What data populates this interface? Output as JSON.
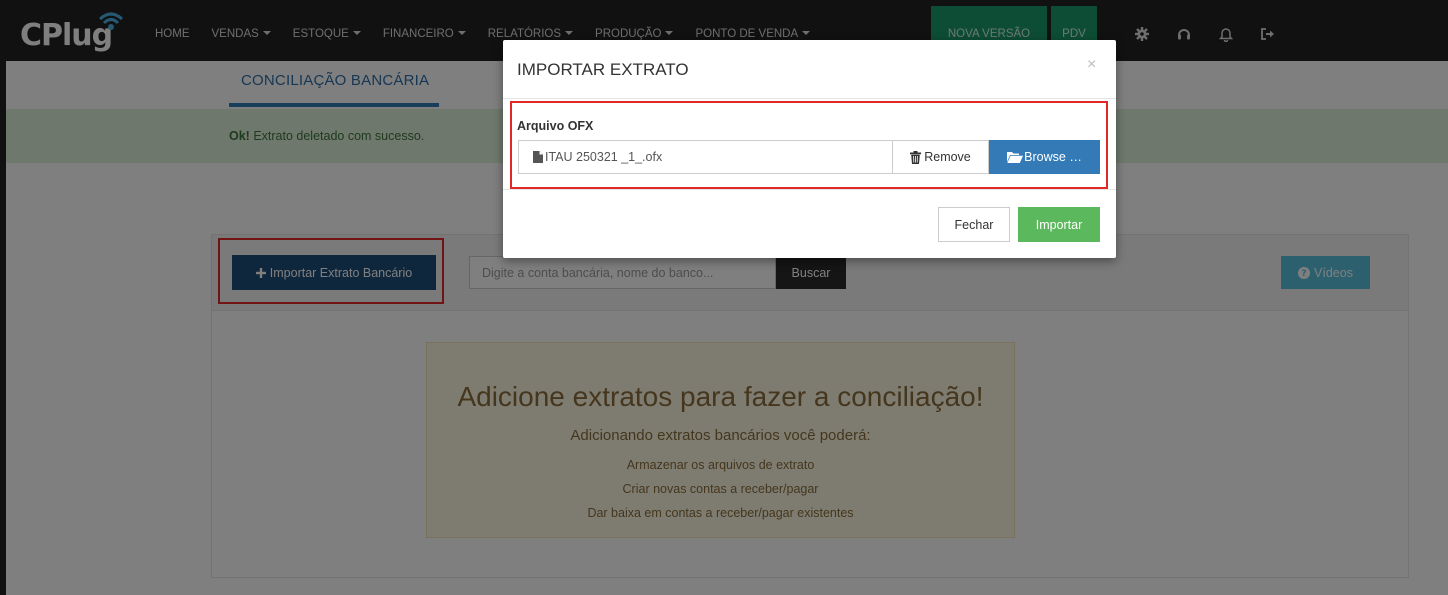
{
  "navbar": {
    "logo_text": "CPlug",
    "items": [
      {
        "label": "HOME",
        "dropdown": false
      },
      {
        "label": "VENDAS",
        "dropdown": true
      },
      {
        "label": "ESTOQUE",
        "dropdown": true
      },
      {
        "label": "FINANCEIRO",
        "dropdown": true
      },
      {
        "label": "RELATÓRIOS",
        "dropdown": true
      },
      {
        "label": "PRODUÇÃO",
        "dropdown": true
      },
      {
        "label": "PONTO DE VENDA",
        "dropdown": true
      }
    ],
    "nova_versao": "NOVA VERSÃO",
    "pdv": "PDV",
    "icons": [
      "gear-icon",
      "headset-icon",
      "bell-icon",
      "logout-icon"
    ]
  },
  "page": {
    "tab_label": "CONCILIAÇÃO BANCÁRIA",
    "alert_strong": "Ok!",
    "alert_text": " Extrato deletado com sucesso.",
    "import_button": "Importar Extrato Bancário",
    "search_placeholder": "Digite a conta bancária, nome do banco...",
    "search_button": "Buscar",
    "videos_button": "Vídeos",
    "empty_title": "Adicione extratos para fazer a conciliação!",
    "empty_subtitle": "Adicionando extratos bancários você poderá:",
    "empty_items": [
      "Armazenar os arquivos de extrato",
      "Criar novas contas a receber/pagar",
      "Dar baixa em contas a receber/pagar existentes"
    ]
  },
  "modal": {
    "title": "IMPORTAR EXTRATO",
    "close": "×",
    "field_label": "Arquivo OFX",
    "file_name": "ITAU 250321 _1_.ofx",
    "remove_button": "Remove",
    "browse_button": "Browse …",
    "fechar_button": "Fechar",
    "importar_button": "Importar"
  },
  "colors": {
    "navbar_bg": "#222222",
    "accent_green": "#1a9a6a",
    "primary_blue": "#337ab7",
    "success_green": "#5cb85c",
    "highlight_red": "#e02828"
  }
}
